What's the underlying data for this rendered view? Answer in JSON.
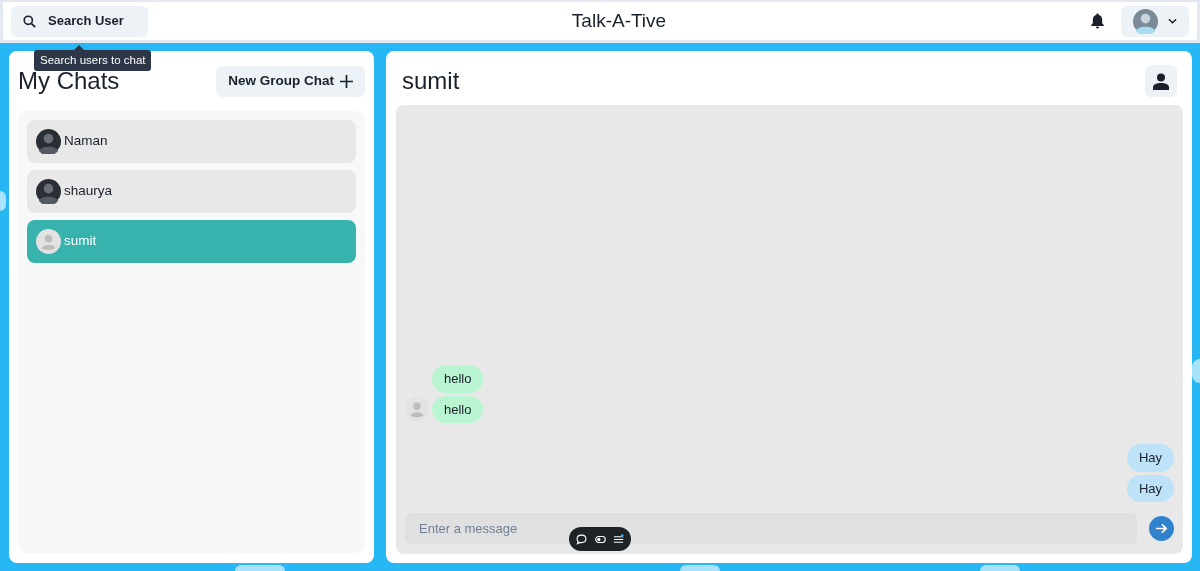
{
  "header": {
    "search_button": "Search User",
    "tooltip": "Search users to chat",
    "title": "Talk-A-Tive"
  },
  "sidebar": {
    "title": "My Chats",
    "new_group_button": "New Group Chat",
    "chats": [
      {
        "name": "Naman",
        "kind": "photo",
        "selected": false
      },
      {
        "name": "shaurya",
        "kind": "photo",
        "selected": false
      },
      {
        "name": "sumit",
        "kind": "default",
        "selected": true
      }
    ]
  },
  "chat": {
    "title": "sumit",
    "messages": [
      {
        "text": "hello",
        "from_me": false,
        "show_avatar": false
      },
      {
        "text": "hello",
        "from_me": false,
        "show_avatar": true
      },
      {
        "text": "Hay",
        "from_me": true,
        "show_avatar": false
      },
      {
        "text": "Hay",
        "from_me": true,
        "show_avatar": false
      }
    ],
    "input": {
      "placeholder": "Enter a message"
    }
  }
}
